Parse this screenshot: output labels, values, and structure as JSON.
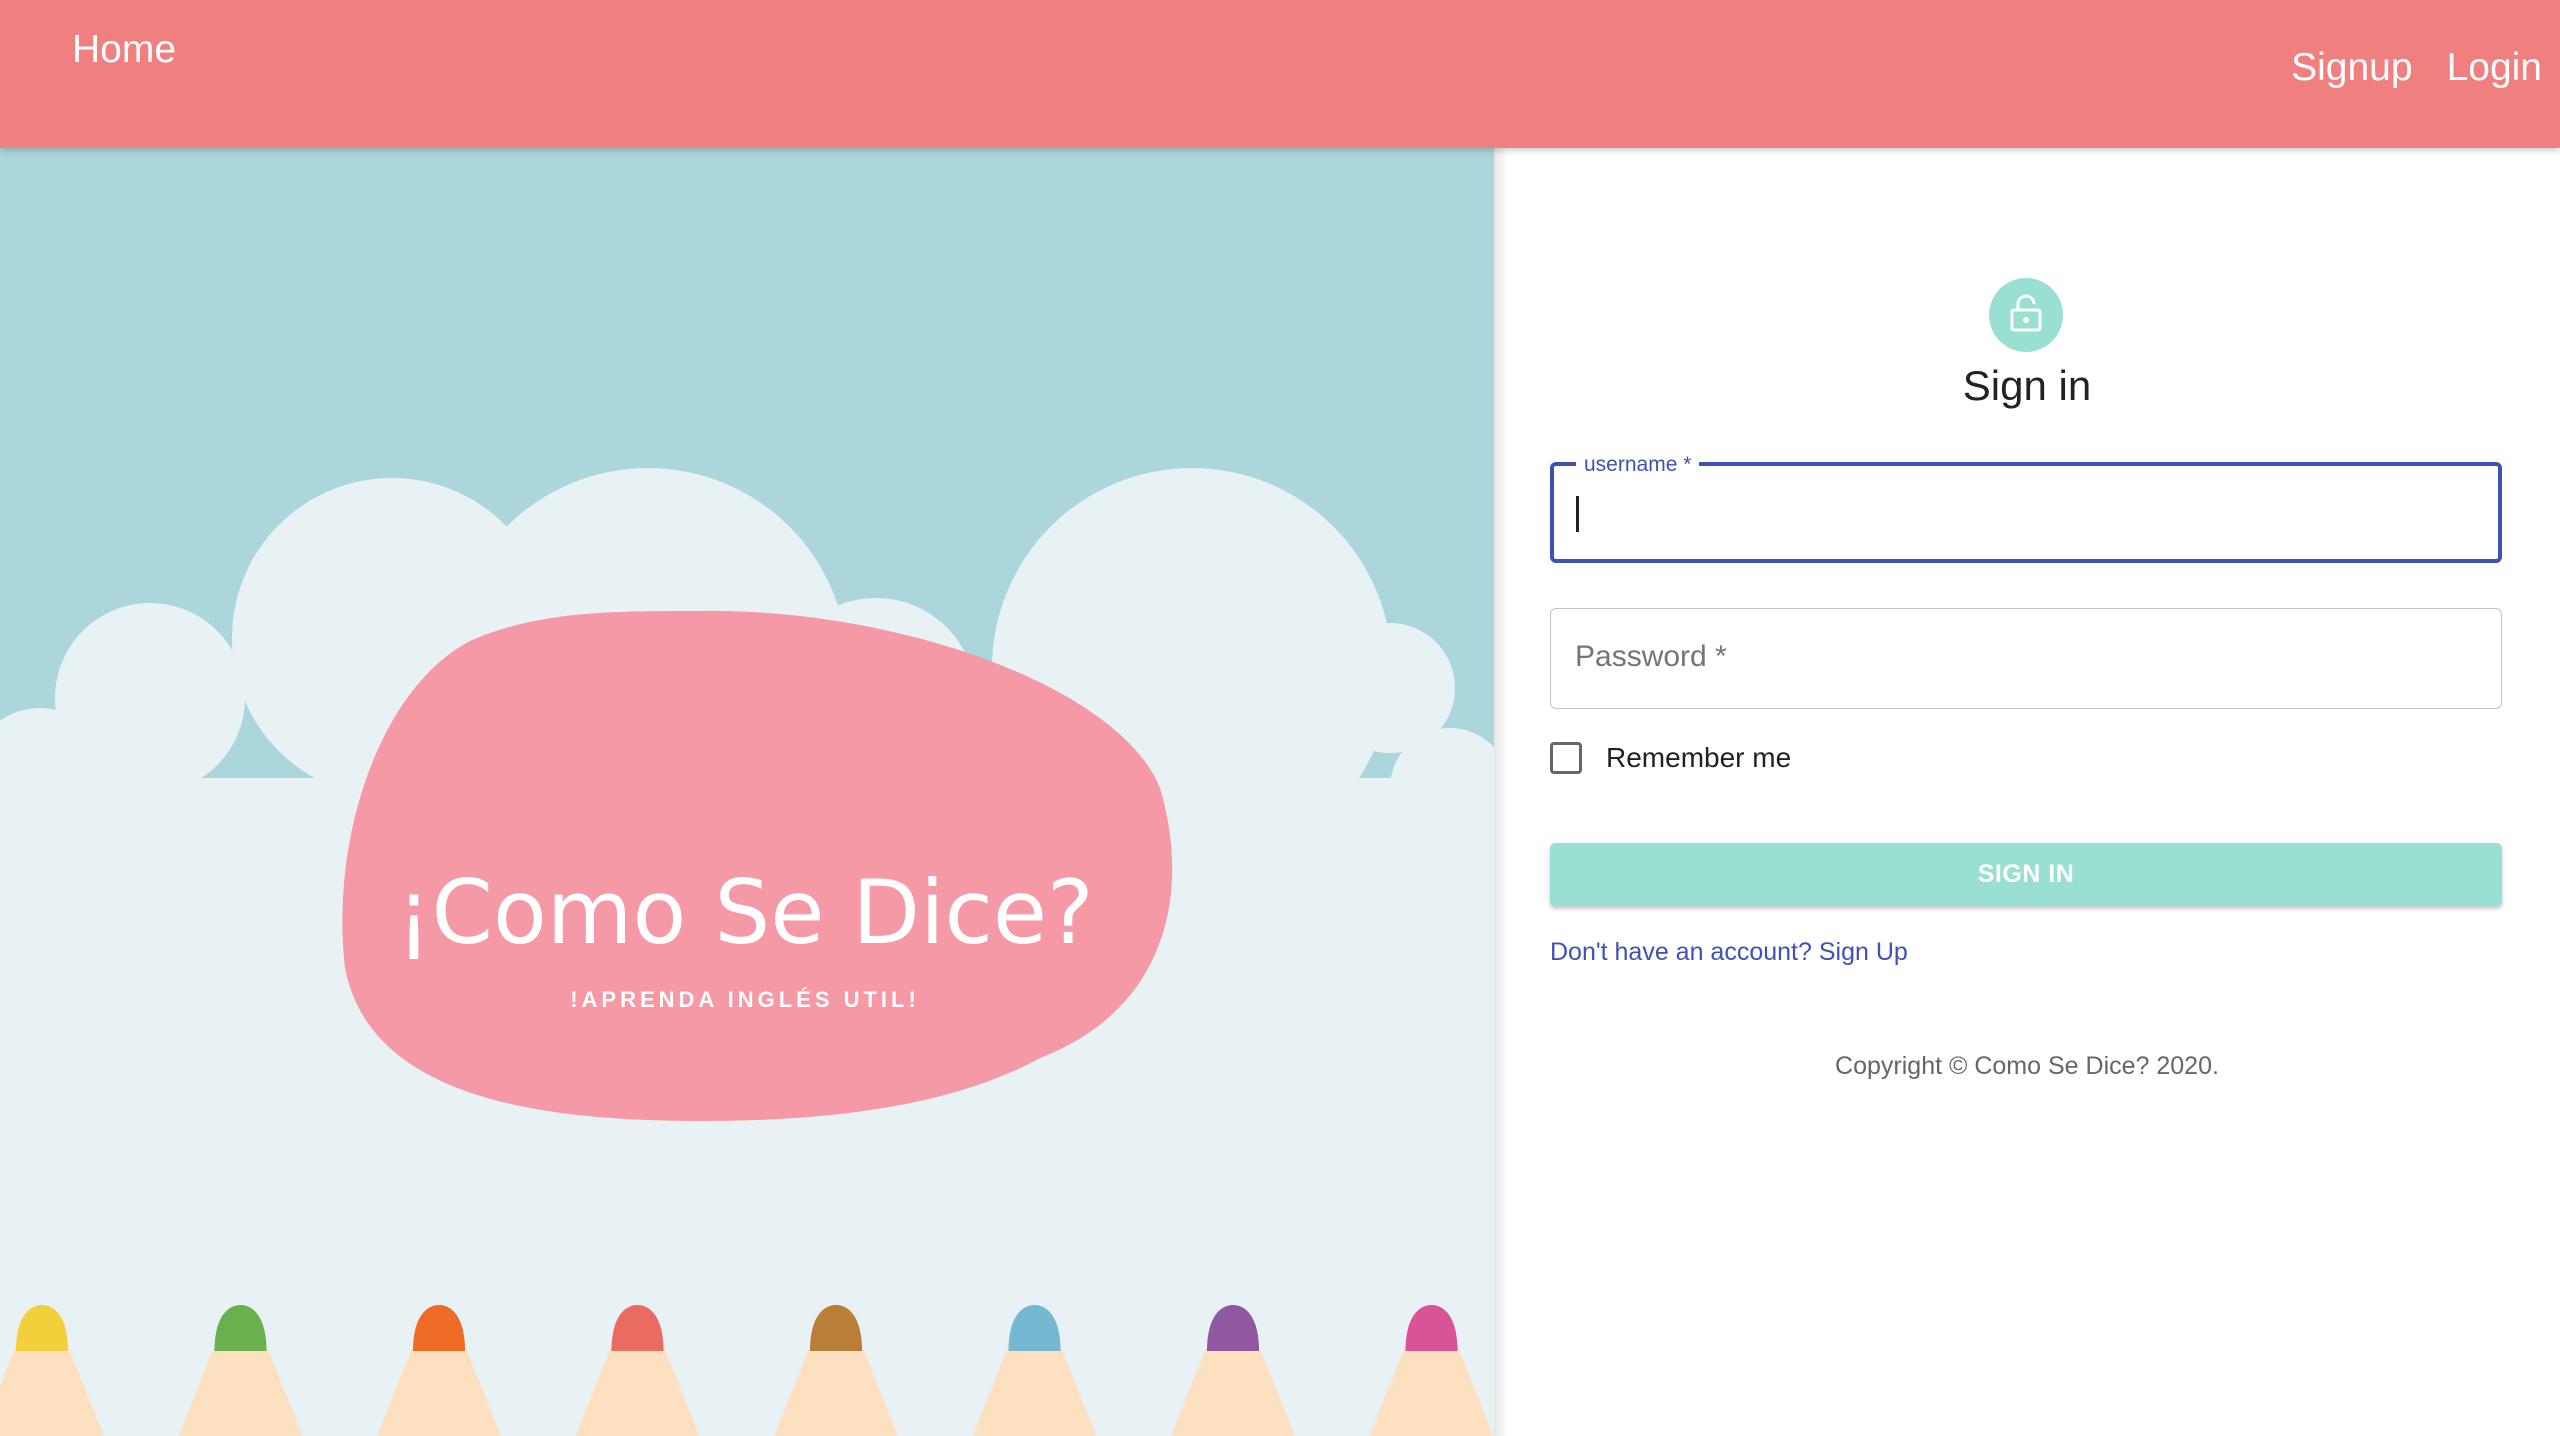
{
  "nav": {
    "home": "Home",
    "signup": "Signup",
    "login": "Login"
  },
  "hero": {
    "title": "¡Como Se Dice?",
    "tagline": "!APRENDA INGLÉS UTIL!"
  },
  "form": {
    "heading": "Sign in",
    "icon": "lock-icon",
    "username_label": "username *",
    "username_value": "",
    "password_placeholder": "Password *",
    "password_value": "",
    "remember_label": "Remember me",
    "remember_checked": false,
    "submit_label": "SIGN IN",
    "signup_link": "Don't have an account? Sign Up",
    "copyright": "Copyright © Como Se Dice? 2020."
  },
  "colors": {
    "header": "#f08080",
    "accent": "#99e0d3",
    "focus": "#3f51b5",
    "sky": "#aad6dc",
    "cloud": "#e8f2f4",
    "blob": "#f499a5"
  },
  "pencils": [
    {
      "color": "#f2cf3b"
    },
    {
      "color": "#6ab04c"
    },
    {
      "color": "#ee6c26"
    },
    {
      "color": "#e96b62"
    },
    {
      "color": "#b97e38"
    },
    {
      "color": "#74b8d1"
    },
    {
      "color": "#8f58a0"
    },
    {
      "color": "#d85496"
    }
  ]
}
